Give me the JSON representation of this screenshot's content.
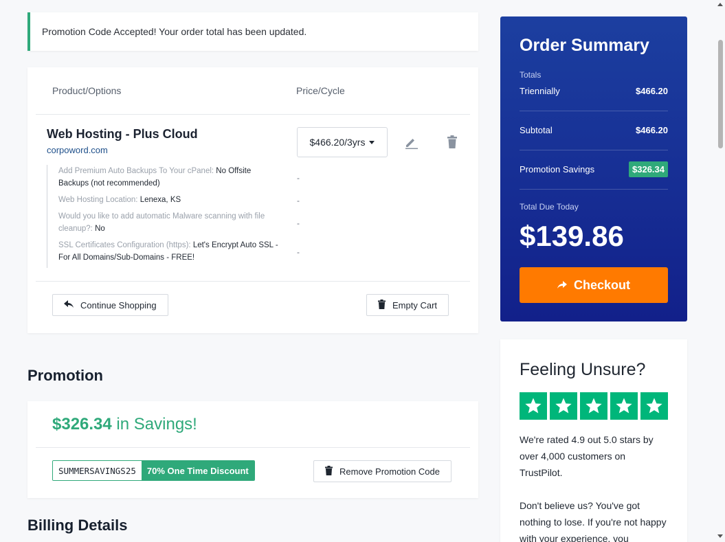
{
  "alert": {
    "message": "Promotion Code Accepted! Your order total has been updated."
  },
  "cart": {
    "col_product": "Product/Options",
    "col_price": "Price/Cycle",
    "product": {
      "title": "Web Hosting - Plus Cloud",
      "domain": "corpoword.com",
      "price_cycle": "$466.20/3yrs",
      "options": [
        {
          "label": "Add Premium Auto Backups To Your cPanel: ",
          "value": "No Offsite Backups (not recommended)",
          "price": "-"
        },
        {
          "label": "Web Hosting Location: ",
          "value": "Lenexa, KS",
          "price": "-"
        },
        {
          "label": "Would you like to add automatic Malware scanning with file cleanup?: ",
          "value": "No",
          "price": "-"
        },
        {
          "label": "SSL Certificates Configuration (https): ",
          "value": "Let's Encrypt Auto SSL - For All Domains/Sub-Domains - FREE!",
          "price": "-"
        }
      ]
    },
    "continue_label": "Continue Shopping",
    "empty_label": "Empty Cart"
  },
  "promotion": {
    "heading": "Promotion",
    "savings_amount": "$326.34",
    "savings_suffix": " in Savings!",
    "code": "SUMMERSAVINGS25",
    "discount": "70% One Time Discount",
    "remove_label": "Remove Promotion Code"
  },
  "billing": {
    "heading": "Billing Details"
  },
  "summary": {
    "title": "Order Summary",
    "totals_label": "Totals",
    "cycle_label": "Triennially",
    "cycle_amount": "$466.20",
    "subtotal_label": "Subtotal",
    "subtotal_amount": "$466.20",
    "savings_label": "Promotion Savings",
    "savings_amount": "$326.34",
    "due_label": "Total Due Today",
    "due_amount": "$139.86",
    "checkout_label": "Checkout"
  },
  "trust": {
    "title": "Feeling Unsure?",
    "rating_text": "We're rated 4.9 out 5.0 stars by over 4,000 customers on TrustPilot.",
    "body_text": "Don't believe us? You've got nothing to lose. If you're not happy with your experience, you",
    "stars": 5
  },
  "colors": {
    "accent_green": "#2fa97a",
    "summary_blue": "#1c3fa0",
    "checkout_orange": "#ff7a00",
    "trustpilot_green": "#00b67a"
  }
}
